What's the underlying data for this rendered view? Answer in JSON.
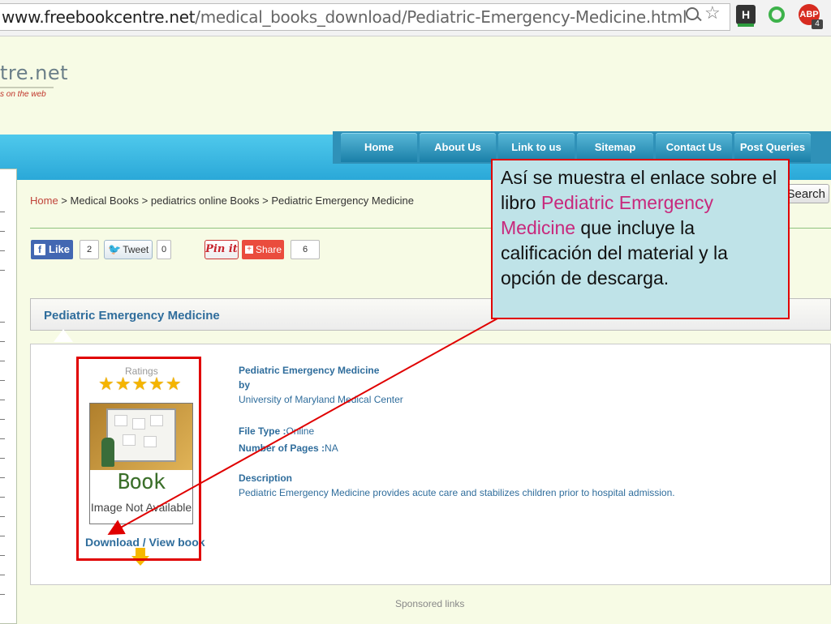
{
  "browser": {
    "url_domain": "www.freebookcentre.net",
    "url_path": "/medical_books_download/Pediatric-Emergency-Medicine.html",
    "extensions": [
      "zoom-icon",
      "bookmark-star-icon",
      "h-extension-icon",
      "green-circle-extension-icon",
      "adblock-plus-icon"
    ],
    "abp_label": "ABP",
    "abp_count": "4",
    "h_label": "H"
  },
  "site": {
    "logo_text": "tre.net",
    "tagline": "s on the web"
  },
  "nav": {
    "items": [
      "Home",
      "About Us",
      "Link to us",
      "Sitemap",
      "Contact Us",
      "Post Queries"
    ]
  },
  "breadcrumb": {
    "home": "Home",
    "rest": " > Medical Books > pediatrics online Books > Pediatric Emergency Medicine"
  },
  "search": {
    "button_label": "Search"
  },
  "social": {
    "like_label": "Like",
    "like_count": "2",
    "tweet_label": "Tweet",
    "tweet_count": "0",
    "pinit_label": "Pin it",
    "share_label": "Share",
    "share_count": "6"
  },
  "panel": {
    "title": "Pediatric Emergency Medicine"
  },
  "book": {
    "ratings_label": "Ratings",
    "stars": "★★★★★",
    "rating_value": 5,
    "cover_title": "Book",
    "cover_subtitle": "Image Not Available",
    "download_label": "Download / View book",
    "title": "Pediatric Emergency Medicine",
    "by_label": "by",
    "author": "University of Maryland Medical Center",
    "file_type_label": "File Type :",
    "file_type": "Online",
    "pages_label": "Number of Pages :",
    "pages": "NA",
    "description_label": "Description",
    "description": "Pediatric Emergency Medicine provides acute care and stabilizes children prior to hospital admission."
  },
  "footer": {
    "sponsored": "Sponsored links"
  },
  "callout": {
    "text_before": "Así se muestra el enlace sobre el libro ",
    "highlight": "Pediatric Emergency Medicine",
    "text_after": " que incluye la calificación del material y la opción de descarga.",
    "highlight_color": "#c8287c",
    "border_color": "#e00000",
    "background": "#bfe3e8"
  }
}
